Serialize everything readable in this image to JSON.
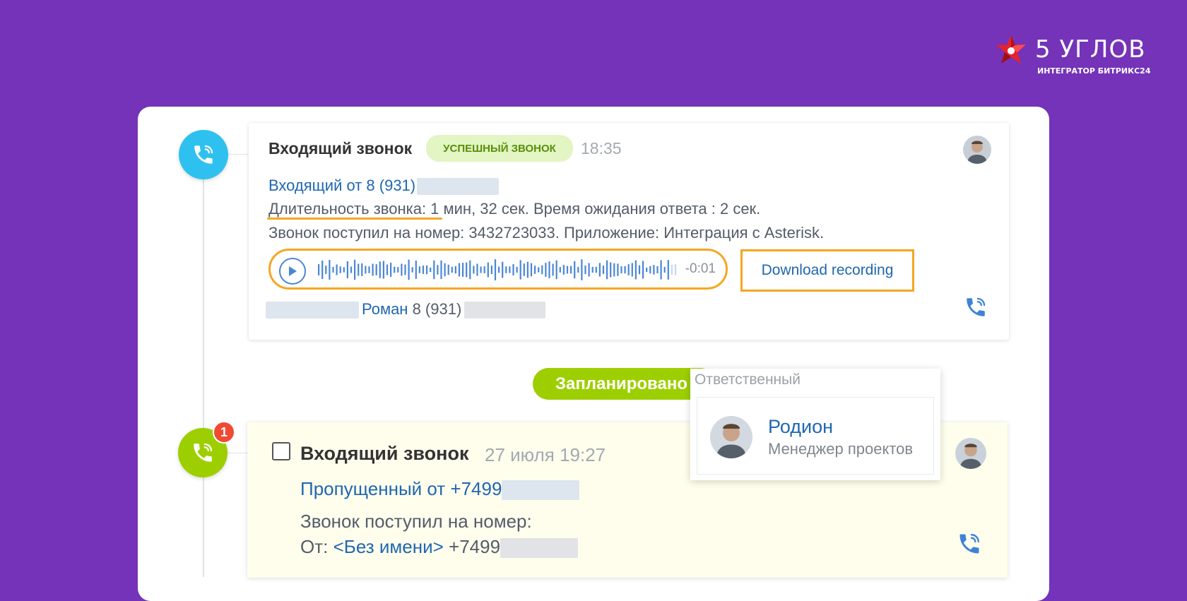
{
  "brand": {
    "title": "5 УГЛОВ",
    "subtitle": "ИНТЕГРАТОР БИТРИКС24",
    "star_color": "#e4222e"
  },
  "call1": {
    "title": "Входящий звонок",
    "status_badge": "УСПЕШНЫЙ ЗВОНОК",
    "time": "18:35",
    "incoming_from": "Входящий от 8 (931)",
    "duration_label": "Длительность звонка:",
    "duration_value": " 1 мин, 32 сек. Время ожидания ответа : 2 сек.",
    "received_line": "Звонок поступил на номер: 3432723033. Приложение: Интеграция с Asterisk.",
    "player_remaining": "-0:01",
    "download_label": "Download recording",
    "contact_name": "Роман",
    "contact_phone": " 8 (931)"
  },
  "scheduled": {
    "pill_label": "Запланировано"
  },
  "responsible_popup": {
    "label": "Ответственный",
    "name": "Родион",
    "role": "Менеджер проектов"
  },
  "call2": {
    "title": "Входящий звонок",
    "time": "27 июля 19:27",
    "missed_from": "Пропущенный от +7499",
    "received_line": "Звонок поступил на номер:",
    "from_label": "От: ",
    "from_name": "<Без имени>",
    "from_phone": " +7499",
    "notification_count": "1"
  },
  "colors": {
    "background": "#7433b8",
    "accent_orange": "#f6a623",
    "call_icon_blue": "#2ec1ef",
    "call_icon_green": "#9dcf00",
    "link_blue": "#2067b0"
  },
  "icons": [
    "phone-icon",
    "play-icon",
    "waveform",
    "avatar",
    "notification-badge",
    "star-logo"
  ]
}
